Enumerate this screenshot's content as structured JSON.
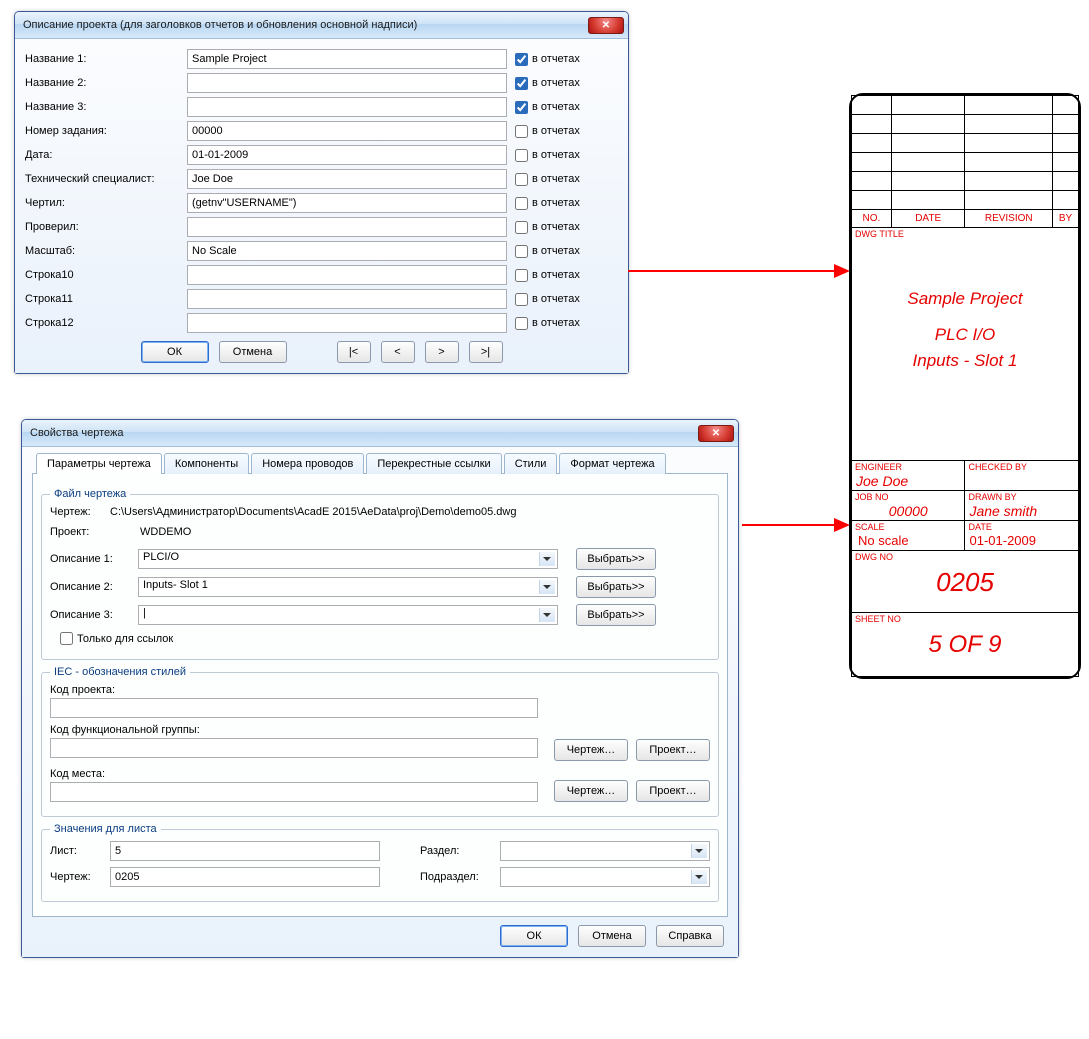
{
  "dialog1": {
    "title": "Описание проекта  (для заголовков отчетов и обновления основной надписи)",
    "fields": [
      {
        "label": "Название 1:",
        "value": "Sample Project",
        "checked": true
      },
      {
        "label": "Название 2:",
        "value": "",
        "checked": true
      },
      {
        "label": "Название 3:",
        "value": "",
        "checked": true
      },
      {
        "label": "Номер задания:",
        "value": "00000",
        "checked": false
      },
      {
        "label": "Дата:",
        "value": "01-01-2009",
        "checked": false
      },
      {
        "label": "Технический специалист:",
        "value": "Joe Doe",
        "checked": false
      },
      {
        "label": "Чертил:",
        "value": "(getnv\"USERNAME\")",
        "checked": false
      },
      {
        "label": "Проверил:",
        "value": "",
        "checked": false
      },
      {
        "label": "Масштаб:",
        "value": "No Scale",
        "checked": false
      },
      {
        "label": "Строка10",
        "value": "",
        "checked": false
      },
      {
        "label": "Строка11",
        "value": "",
        "checked": false
      },
      {
        "label": "Строка12",
        "value": "",
        "checked": false
      }
    ],
    "checkbox_label": "в отчетах",
    "ok_label": "ОК",
    "cancel_label": "Отмена",
    "nav": {
      "first": "|<",
      "prev": "<",
      "next": ">",
      "last": ">|"
    }
  },
  "dialog2": {
    "title": "Свойства чертежа",
    "tabs": [
      "Параметры чертежа",
      "Компоненты",
      "Номера проводов",
      "Перекрестные ссылки",
      "Стили",
      "Формат чертежа"
    ],
    "active_tab": 0,
    "file_group": {
      "legend": "Файл чертежа",
      "drawing_label": "Чертеж:",
      "drawing_path": "C:\\Users\\Администратор\\Documents\\AcadE 2015\\AeData\\proj\\Demo\\demo05.dwg",
      "project_label": "Проект:",
      "project_value": "WDDEMO",
      "desc_rows": [
        {
          "label": "Описание 1:",
          "value": "PLCI/O"
        },
        {
          "label": "Описание 2:",
          "value": "Inputs- Slot 1"
        },
        {
          "label": "Описание 3:",
          "value": "|"
        }
      ],
      "select_btn": "Выбрать>>",
      "ref_only_label": "Только для ссылок"
    },
    "iec_group": {
      "legend": "IEC - обозначения стилей",
      "proj_code": "Код проекта:",
      "func_code": "Код функциональной группы:",
      "loc_code": "Код места:",
      "drawing_btn": "Чертеж…",
      "project_btn": "Проект…"
    },
    "sheet_group": {
      "legend": "Значения для листа",
      "sheet_label": "Лист:",
      "sheet_value": "5",
      "dwg_label": "Чертеж:",
      "dwg_value": "0205",
      "section_label": "Раздел:",
      "subsection_label": "Подраздел:"
    },
    "ok_label": "ОК",
    "cancel_label": "Отмена",
    "help_label": "Справка"
  },
  "titleblock": {
    "rev_headers": [
      "NO.",
      "DATE",
      "REVISION",
      "BY"
    ],
    "dwg_title_label": "DWG TITLE",
    "project_name": "Sample Project",
    "line2": "PLC I/O",
    "line3": "Inputs - Slot 1",
    "engineer_label": "ENGINEER",
    "engineer": "Joe Doe",
    "checked_label": "CHECKED BY",
    "checked": "",
    "job_label": "JOB NO",
    "job": "00000",
    "drawn_label": "DRAWN BY",
    "drawn": "Jane smith",
    "scale_label": "SCALE",
    "scale": "No scale",
    "date_label": "DATE",
    "date": "01-01-2009",
    "dwgno_label": "DWG NO",
    "dwgno": "0205",
    "sheetno_label": "SHEET NO",
    "sheetno": "5 OF 9"
  }
}
